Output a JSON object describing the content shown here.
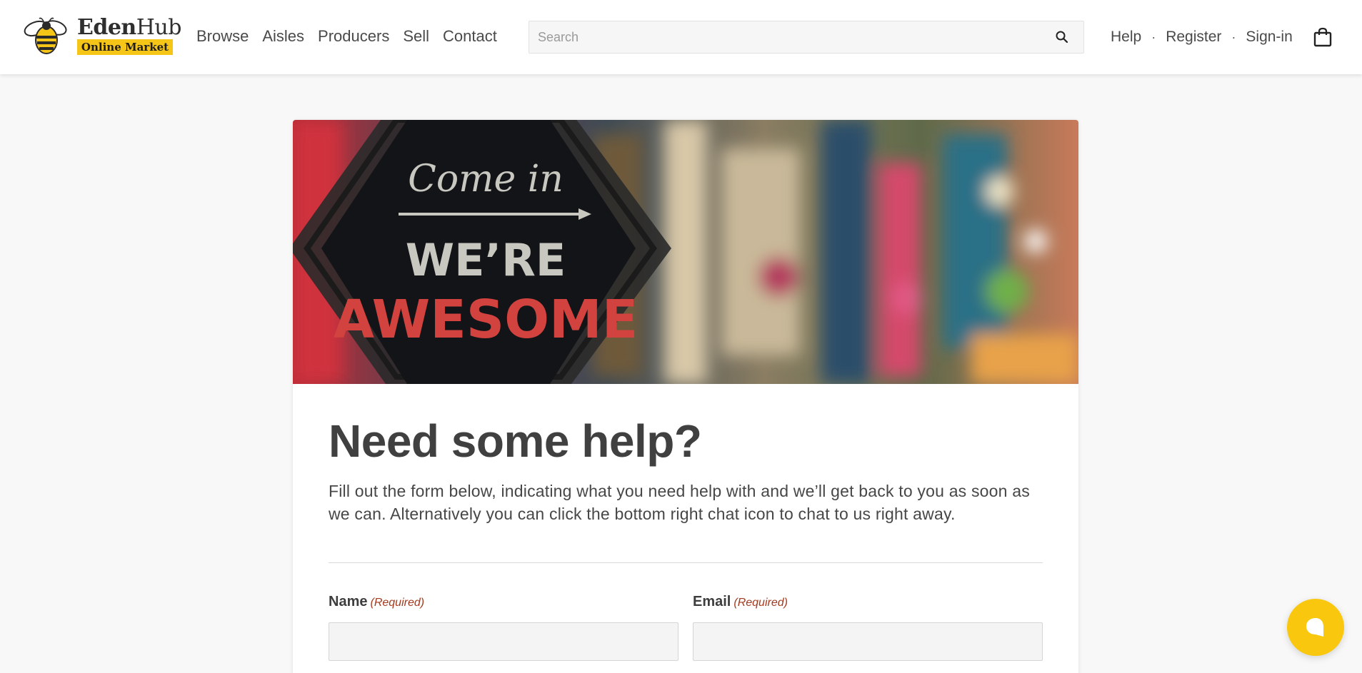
{
  "brand": {
    "name_bold": "Eden",
    "name_rest": "Hub",
    "tagline": "Online Market",
    "accent_color": "#f5c518",
    "logo_icon": "bee-icon"
  },
  "nav": {
    "items": [
      {
        "label": "Browse"
      },
      {
        "label": "Aisles"
      },
      {
        "label": "Producers"
      },
      {
        "label": "Sell"
      },
      {
        "label": "Contact"
      }
    ]
  },
  "search": {
    "placeholder": "Search",
    "value": "",
    "icon": "search-icon"
  },
  "user_links": {
    "help": "Help",
    "register": "Register",
    "signin": "Sign-in",
    "separator": "·",
    "cart_icon": "shopping-bag-icon"
  },
  "hero": {
    "sign_script": "Come in",
    "sign_line1": "WE’RE",
    "sign_line2": "AWESOME"
  },
  "page": {
    "title": "Need some help?",
    "intro": "Fill out the form below, indicating what you need help with and we’ll get back to you as soon as we can. Alternatively you can click the bottom right chat icon to chat to us right away."
  },
  "form": {
    "name_label": "Name",
    "name_required": "(Required)",
    "name_value": "",
    "email_label": "Email",
    "email_required": "(Required)",
    "email_value": "",
    "required_color": "#a33a1e"
  },
  "chat": {
    "icon": "chat-bubble-icon",
    "color": "#f9c80e"
  }
}
